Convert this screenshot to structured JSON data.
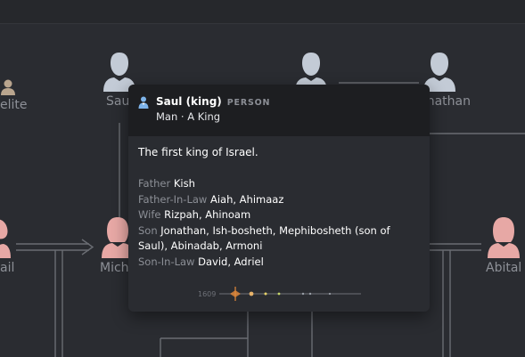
{
  "graph": {
    "nodes": [
      {
        "id": "n1",
        "label": "elite",
        "color": "#b9a58e"
      },
      {
        "id": "n2",
        "label": "Saul",
        "color": "#c3cbd6"
      },
      {
        "id": "n3",
        "label": "Jonathan",
        "color": "#c3cbd6"
      },
      {
        "id": "n4",
        "label": "ail",
        "color": "#e7a8a5"
      },
      {
        "id": "n5",
        "label": "Mich",
        "color": "#e7a8a5"
      },
      {
        "id": "n6",
        "label": "Abital",
        "color": "#e7a8a5"
      }
    ]
  },
  "popover": {
    "title": "Saul (king)",
    "type_badge": "PERSON",
    "subtitle": "Man · A King",
    "description": "The first king of Israel.",
    "relations": [
      {
        "key": "Father",
        "value": "Kish"
      },
      {
        "key": "Father-In-Law",
        "value": "Aiah, Ahimaaz"
      },
      {
        "key": "Wife",
        "value": "Rizpah, Ahinoam"
      },
      {
        "key": "Son",
        "value": "Jonathan, Ish-bosheth, Mephibosheth (son of Saul), Abinadab, Armoni"
      },
      {
        "key": "Son-In-Law",
        "value": "David, Adriel"
      }
    ],
    "timeline": {
      "year_label": "1609"
    },
    "icon": "person-icon"
  },
  "colors": {
    "background": "#2a2c31",
    "popover_header": "#1d1e21",
    "male_icon": "#c3cbd6",
    "female_icon": "#e7a8a5",
    "accent_blue": "#7eb4ea",
    "timeline_orange": "#e58a3a"
  }
}
